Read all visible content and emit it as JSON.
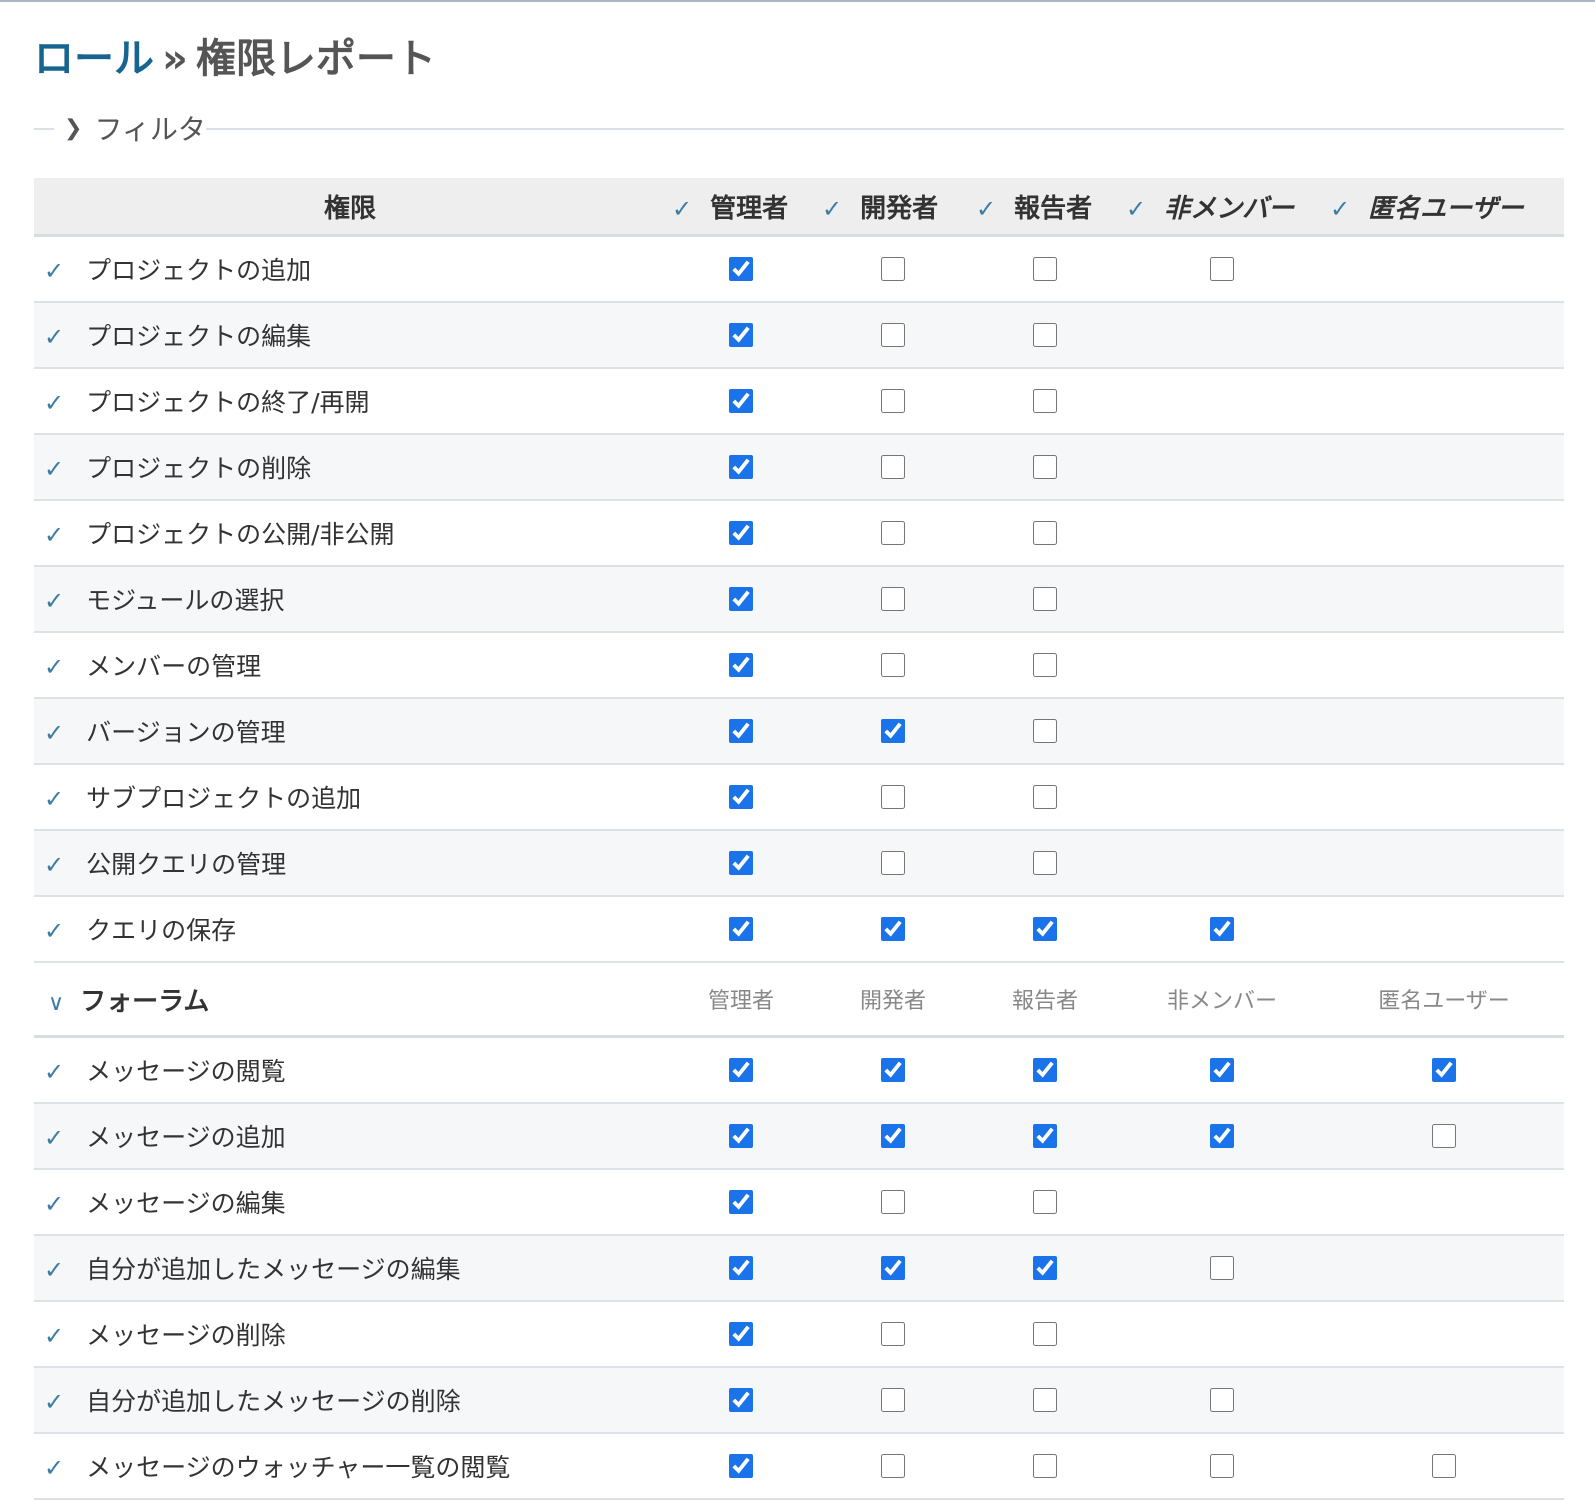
{
  "header": {
    "breadcrumb_link": "ロール",
    "separator": "»",
    "page_title": "権限レポート"
  },
  "filter": {
    "chevron_icon": "chevron-right-icon",
    "label": "フィルタ"
  },
  "table": {
    "permission_header": "権限",
    "check_icon": "check-icon",
    "roles": [
      {
        "id": "manager",
        "label": "管理者",
        "builtin": false
      },
      {
        "id": "developer",
        "label": "開発者",
        "builtin": false
      },
      {
        "id": "reporter",
        "label": "報告者",
        "builtin": false
      },
      {
        "id": "non-member",
        "label": "非メンバー",
        "builtin": true
      },
      {
        "id": "anonymous",
        "label": "匿名ユーザー",
        "builtin": true
      }
    ],
    "general_permissions": [
      {
        "name": "プロジェクトの追加",
        "values": [
          true,
          false,
          false,
          false,
          null
        ]
      },
      {
        "name": "プロジェクトの編集",
        "values": [
          true,
          false,
          false,
          null,
          null
        ]
      },
      {
        "name": "プロジェクトの終了/再開",
        "values": [
          true,
          false,
          false,
          null,
          null
        ]
      },
      {
        "name": "プロジェクトの削除",
        "values": [
          true,
          false,
          false,
          null,
          null
        ]
      },
      {
        "name": "プロジェクトの公開/非公開",
        "values": [
          true,
          false,
          false,
          null,
          null
        ]
      },
      {
        "name": "モジュールの選択",
        "values": [
          true,
          false,
          false,
          null,
          null
        ]
      },
      {
        "name": "メンバーの管理",
        "values": [
          true,
          false,
          false,
          null,
          null
        ]
      },
      {
        "name": "バージョンの管理",
        "values": [
          true,
          true,
          false,
          null,
          null
        ]
      },
      {
        "name": "サブプロジェクトの追加",
        "values": [
          true,
          false,
          false,
          null,
          null
        ]
      },
      {
        "name": "公開クエリの管理",
        "values": [
          true,
          false,
          false,
          null,
          null
        ]
      },
      {
        "name": "クエリの保存",
        "values": [
          true,
          true,
          true,
          true,
          null
        ]
      }
    ],
    "groups": [
      {
        "name": "フォーラム",
        "expander_icon": "chevron-down-icon",
        "permissions": [
          {
            "name": "メッセージの閲覧",
            "values": [
              true,
              true,
              true,
              true,
              true
            ]
          },
          {
            "name": "メッセージの追加",
            "values": [
              true,
              true,
              true,
              true,
              false
            ]
          },
          {
            "name": "メッセージの編集",
            "values": [
              true,
              false,
              false,
              null,
              null
            ]
          },
          {
            "name": "自分が追加したメッセージの編集",
            "values": [
              true,
              true,
              true,
              false,
              null
            ]
          },
          {
            "name": "メッセージの削除",
            "values": [
              true,
              false,
              false,
              null,
              null
            ]
          },
          {
            "name": "自分が追加したメッセージの削除",
            "values": [
              true,
              false,
              false,
              false,
              null
            ]
          },
          {
            "name": "メッセージのウォッチャー一覧の閲覧",
            "values": [
              true,
              false,
              false,
              false,
              false
            ]
          }
        ]
      }
    ]
  }
}
